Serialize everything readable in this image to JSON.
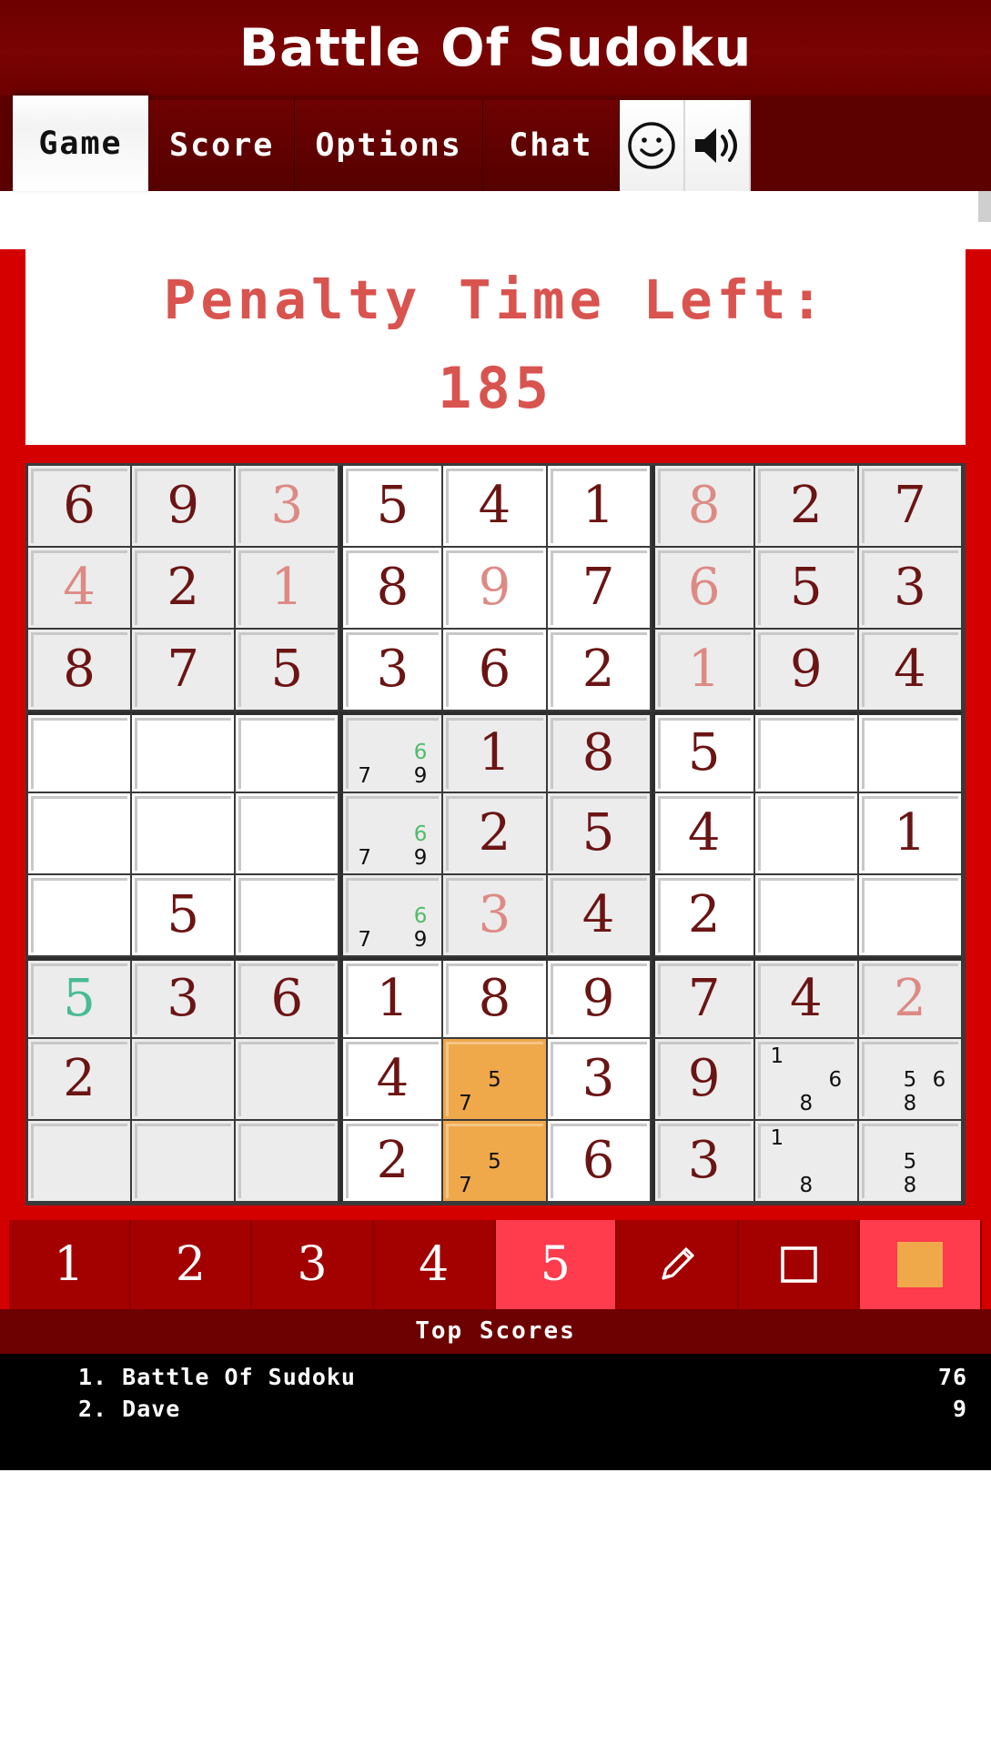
{
  "app": {
    "title": "Battle Of Sudoku"
  },
  "tabs": [
    {
      "label": "Game",
      "active": true
    },
    {
      "label": "Score",
      "active": false
    },
    {
      "label": "Options",
      "active": false
    },
    {
      "label": "Chat",
      "active": false
    }
  ],
  "tab_icons": [
    {
      "name": "smiley-icon"
    },
    {
      "name": "sound-on-icon"
    }
  ],
  "penalty": {
    "label": "Penalty Time Left:",
    "value": "185",
    "color": "#d9534f"
  },
  "numpad": {
    "buttons": [
      "1",
      "2",
      "3",
      "4",
      "5"
    ],
    "selected": "5",
    "pencil_icon": "pencil-icon",
    "square_icon": "square-outline-icon",
    "color_swatch": "#efa84a"
  },
  "scores": {
    "header": "Top Scores",
    "rows": [
      {
        "rank": "1. Battle Of Sudoku",
        "points": "76"
      },
      {
        "rank": "2. Dave",
        "points": "9"
      }
    ]
  },
  "colors": {
    "brand_dark": "#6d0000",
    "brand_red": "#d40000",
    "accent_red": "#ff3b4e",
    "given": "#6b1414",
    "player": "#dd8a85",
    "correct": "#49bb92",
    "note_green": "#4fbb6a",
    "highlight": "#efa84a",
    "cell_shade": "#ececec"
  },
  "board": {
    "rows": [
      [
        {
          "v": "6",
          "t": "given"
        },
        {
          "v": "9",
          "t": "given"
        },
        {
          "v": "3",
          "t": "player"
        },
        {
          "v": "5",
          "t": "given"
        },
        {
          "v": "4",
          "t": "given"
        },
        {
          "v": "1",
          "t": "given"
        },
        {
          "v": "8",
          "t": "player"
        },
        {
          "v": "2",
          "t": "given"
        },
        {
          "v": "7",
          "t": "given"
        }
      ],
      [
        {
          "v": "4",
          "t": "player"
        },
        {
          "v": "2",
          "t": "given"
        },
        {
          "v": "1",
          "t": "player"
        },
        {
          "v": "8",
          "t": "given"
        },
        {
          "v": "9",
          "t": "player"
        },
        {
          "v": "7",
          "t": "given"
        },
        {
          "v": "6",
          "t": "player"
        },
        {
          "v": "5",
          "t": "given"
        },
        {
          "v": "3",
          "t": "given"
        }
      ],
      [
        {
          "v": "8",
          "t": "given"
        },
        {
          "v": "7",
          "t": "given"
        },
        {
          "v": "5",
          "t": "given"
        },
        {
          "v": "3",
          "t": "given"
        },
        {
          "v": "6",
          "t": "given"
        },
        {
          "v": "2",
          "t": "given"
        },
        {
          "v": "1",
          "t": "player"
        },
        {
          "v": "9",
          "t": "given"
        },
        {
          "v": "4",
          "t": "given"
        }
      ],
      [
        {
          "v": "",
          "t": ""
        },
        {
          "v": "",
          "t": ""
        },
        {
          "v": "",
          "t": ""
        },
        {
          "v": "",
          "t": "",
          "notes": {
            "7": "plain",
            "6": "green",
            "9": "plain"
          }
        },
        {
          "v": "1",
          "t": "given"
        },
        {
          "v": "8",
          "t": "given"
        },
        {
          "v": "5",
          "t": "given"
        },
        {
          "v": "",
          "t": ""
        },
        {
          "v": "",
          "t": ""
        }
      ],
      [
        {
          "v": "",
          "t": ""
        },
        {
          "v": "",
          "t": ""
        },
        {
          "v": "",
          "t": ""
        },
        {
          "v": "",
          "t": "",
          "notes": {
            "7": "plain",
            "6": "green",
            "9": "plain"
          }
        },
        {
          "v": "2",
          "t": "given"
        },
        {
          "v": "5",
          "t": "given"
        },
        {
          "v": "4",
          "t": "given"
        },
        {
          "v": "",
          "t": ""
        },
        {
          "v": "1",
          "t": "given"
        }
      ],
      [
        {
          "v": "",
          "t": ""
        },
        {
          "v": "5",
          "t": "given"
        },
        {
          "v": "",
          "t": ""
        },
        {
          "v": "",
          "t": "",
          "notes": {
            "7": "plain",
            "6": "green",
            "9": "plain"
          }
        },
        {
          "v": "3",
          "t": "player"
        },
        {
          "v": "4",
          "t": "given"
        },
        {
          "v": "2",
          "t": "given"
        },
        {
          "v": "",
          "t": ""
        },
        {
          "v": "",
          "t": ""
        }
      ],
      [
        {
          "v": "5",
          "t": "correct"
        },
        {
          "v": "3",
          "t": "given"
        },
        {
          "v": "6",
          "t": "given"
        },
        {
          "v": "1",
          "t": "given"
        },
        {
          "v": "8",
          "t": "given"
        },
        {
          "v": "9",
          "t": "given"
        },
        {
          "v": "7",
          "t": "given"
        },
        {
          "v": "4",
          "t": "given"
        },
        {
          "v": "2",
          "t": "player"
        }
      ],
      [
        {
          "v": "2",
          "t": "given"
        },
        {
          "v": "",
          "t": ""
        },
        {
          "v": "",
          "t": ""
        },
        {
          "v": "4",
          "t": "given"
        },
        {
          "v": "",
          "t": "",
          "hl": true,
          "notes": {
            "5": "plain",
            "7": "plain"
          }
        },
        {
          "v": "3",
          "t": "given"
        },
        {
          "v": "9",
          "t": "given"
        },
        {
          "v": "",
          "t": "",
          "notes": {
            "1": "plain",
            "6": "plain",
            "8": "plain"
          }
        },
        {
          "v": "",
          "t": "",
          "notes": {
            "5": "plain",
            "6": "plain",
            "8": "plain"
          }
        }
      ],
      [
        {
          "v": "",
          "t": ""
        },
        {
          "v": "",
          "t": ""
        },
        {
          "v": "",
          "t": ""
        },
        {
          "v": "2",
          "t": "given"
        },
        {
          "v": "",
          "t": "",
          "hl": true,
          "notes": {
            "5": "plain",
            "7": "plain"
          }
        },
        {
          "v": "6",
          "t": "given"
        },
        {
          "v": "3",
          "t": "given"
        },
        {
          "v": "",
          "t": "",
          "notes": {
            "1": "plain",
            "8": "plain"
          }
        },
        {
          "v": "",
          "t": "",
          "notes": {
            "5": "plain",
            "8": "plain"
          }
        }
      ]
    ]
  }
}
